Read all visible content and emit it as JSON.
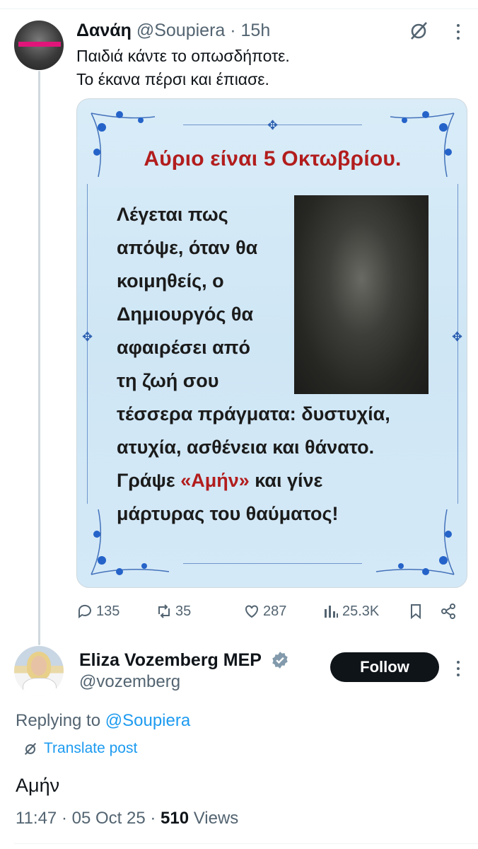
{
  "tweet": {
    "author_name": "Δανάη",
    "handle": "@Soupiera",
    "separator": " · ",
    "time": "15h",
    "text_lines": [
      "Παιδιά κάντε το οπωσδήποτε.",
      "Το έκανα πέρσι και έπιασε."
    ],
    "image": {
      "title": "Αύριο είναι 5 Οκτωβρίου.",
      "lines": [
        "Λέγεται πως",
        "απόψε, όταν θα",
        "κοιμηθείς, ο",
        "Δημιουργός θα",
        "αφαιρέσει από",
        "τη ζωή σου",
        "τέσσερα πράγματα: δυστυχία,",
        "ατυχία, ασθένεια και θάνατο."
      ],
      "last_pre": "Γράψε ",
      "last_red": "«Αμήν»",
      "last_post": " και γίνε",
      "final_line": "μάρτυρας του θαύματος!"
    },
    "actions": {
      "replies": "135",
      "reposts": "35",
      "likes": "287",
      "views": "25.3K"
    }
  },
  "reply": {
    "author_name": "Eliza Vozemberg MEP",
    "handle": "@vozemberg",
    "follow_label": "Follow",
    "replying_prefix": "Replying to ",
    "replying_handle": "@Soupiera",
    "translate_label": "Translate post",
    "text": "Αμήν",
    "time": "11:47",
    "date": "05 Oct 25",
    "views_count": "510",
    "views_label": "Views"
  },
  "colors": {
    "accent": "#1d9bf0",
    "muted": "#536471",
    "red_text": "#b21d1d",
    "card_bg": "#d6eaf8"
  },
  "icons": [
    "grok-icon",
    "more-icon",
    "reply-icon",
    "repost-icon",
    "like-icon",
    "views-icon",
    "bookmark-icon",
    "share-icon",
    "verified-icon",
    "translate-icon"
  ]
}
